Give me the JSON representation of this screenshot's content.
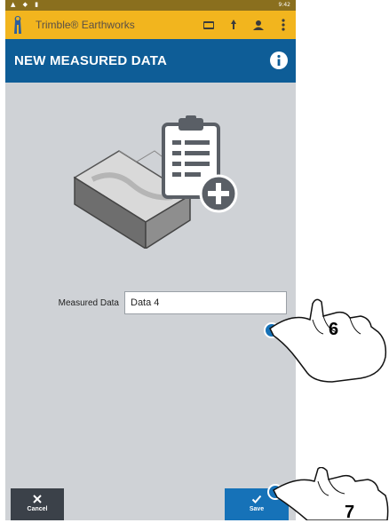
{
  "status_bar": {
    "left_icons": "▲ ◆ ▮",
    "time": "9:42"
  },
  "app_bar": {
    "title": "Trimble® Earthworks",
    "icons": [
      "folder-icon",
      "pin-icon",
      "user-icon",
      "more-vert-icon"
    ]
  },
  "header": {
    "title": "NEW MEASURED DATA",
    "info_icon": "info-icon"
  },
  "form": {
    "label": "Measured Data",
    "value": "Data 4"
  },
  "buttons": {
    "cancel_label": "Cancel",
    "save_label": "Save"
  },
  "annotations": {
    "step_input": "6",
    "step_save": "7"
  },
  "colors": {
    "app_bar": "#f2b51e",
    "header": "#0e5d97",
    "save": "#1672b8",
    "cancel": "#3b4149",
    "background": "#cfd2d6"
  }
}
